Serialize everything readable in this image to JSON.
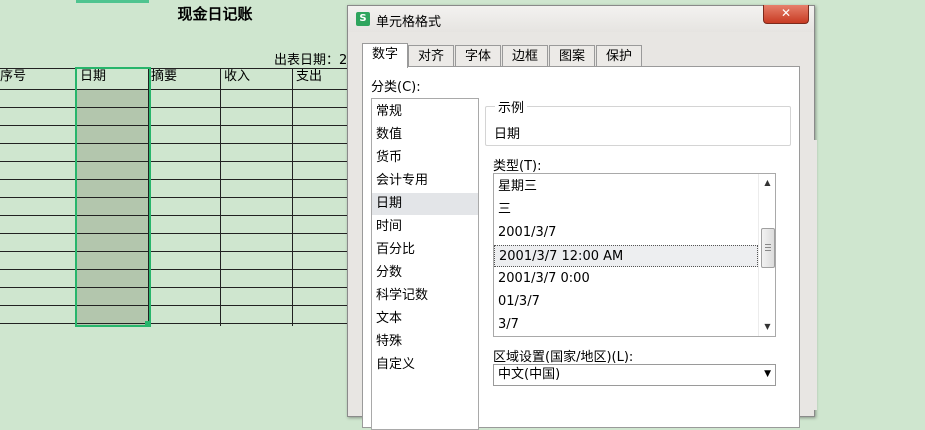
{
  "sheet": {
    "title": "现金日记账",
    "report_date": "出表日期：2",
    "headers": [
      "序号",
      "日期",
      "摘要",
      "收入",
      "支出"
    ]
  },
  "dialog": {
    "title": "单元格格式",
    "app_icon": "S",
    "close_glyph": "✕",
    "tabs": [
      "数字",
      "对齐",
      "字体",
      "边框",
      "图案",
      "保护"
    ],
    "active_tab": "数字",
    "category_label": "分类(C):",
    "categories": [
      "常规",
      "数值",
      "货币",
      "会计专用",
      "日期",
      "时间",
      "百分比",
      "分数",
      "科学记数",
      "文本",
      "特殊",
      "自定义"
    ],
    "selected_category": "日期",
    "sample_label": "示例",
    "sample_value": "日期",
    "type_label": "类型(T):",
    "types": [
      "星期三",
      "三",
      "2001/3/7",
      "2001/3/7 12:00 AM",
      "2001/3/7 0:00",
      "01/3/7",
      "3/7"
    ],
    "selected_type": "2001/3/7 12:00 AM",
    "locale_label": "区域设置(国家/地区)(L):",
    "locale_value": "中文(中国)"
  },
  "icons": {
    "scroll_up": "up-arrow-icon",
    "scroll_down": "down-arrow-icon",
    "dropdown": "chevron-down-icon"
  },
  "colors": {
    "sheet_bg": "#cfe6cf",
    "selection_border": "#27b56b",
    "selection_fill": "#b3c6ad",
    "close_button": "#c83b23",
    "app_icon": "#2fa55e"
  }
}
